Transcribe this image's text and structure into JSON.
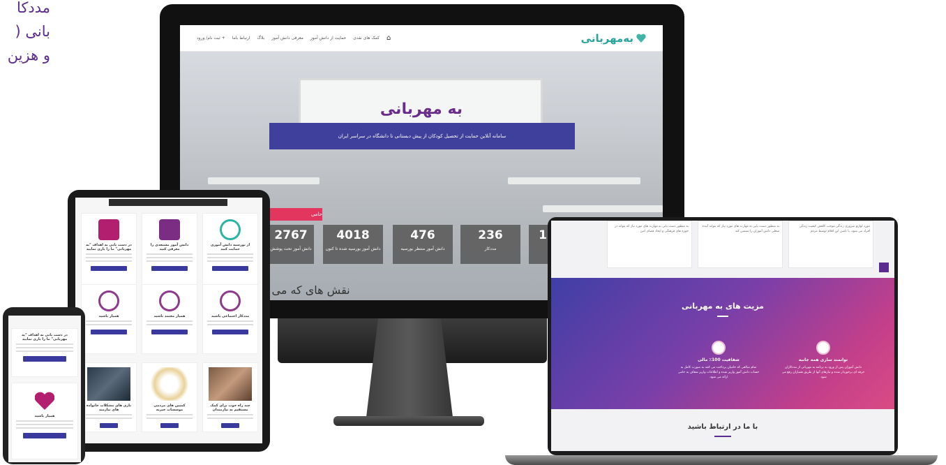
{
  "corner_text": [
    "مددکا",
    "بانی (",
    "و هزین"
  ],
  "monitor": {
    "brand": "به‌مهربانی",
    "nav_links": [
      "کمک های نقدی",
      "حمایت از دانش آموز",
      "معرفی دانش آموز",
      "بلاگ",
      "ارتباط باما",
      "ثبت نام/ ورود +"
    ],
    "hero_title": "به مهربانی",
    "hero_subtitle": "سامانه آنلاین حمایت از تحصیل کودکان از پیش دبستانی تا دانشگاه در سراسر ایران",
    "support_button": "حامی",
    "stats": [
      {
        "num": "2767",
        "label": "دانش آموز تحت پوشش"
      },
      {
        "num": "4018",
        "label": "دانش آموز بورسیه شده تا کنون"
      },
      {
        "num": "476",
        "label": "دانش آموز منتظر بورسیه"
      },
      {
        "num": "236",
        "label": "مددکار"
      },
      {
        "num": "1",
        "label": ""
      }
    ],
    "headline": "نقش های که می توانید در به مهربانی داشته باشید"
  },
  "tablet": {
    "cards": [
      {
        "title": "از بورسیه دانش آموزی حمایت کنید",
        "button": "می خواهم حامی باشم"
      },
      {
        "title": "دانش آموز مستعدی را معرفی کنید",
        "button": "می خواهم دانش آموزی معرفی کنم"
      },
      {
        "title": "در دست یابی به اهداف \"به مهربانی\" ما را یاری نمایید",
        "button": "می خواهم یاری مهربانی باشم"
      },
      {
        "title": "مددکار اجتماعی باشید",
        "button": "می خواهم مددکار باشم"
      },
      {
        "title": "همیار معتمد باشید",
        "button": "می خواهم همیار معتمد باشم"
      },
      {
        "title": "همیار باشید",
        "button": "می خواهم همیار باشم"
      },
      {
        "title": "چند راه خوب برای کمک مستقیم به نیازمندان",
        "button": "بیشتر بخوانید"
      },
      {
        "title": "کمپین های مردمی موسسات خیریه",
        "button": "بیشتر بخوانید"
      },
      {
        "title": "بازی های مشکلات خانواده های نیازمند",
        "button": "بیشتر بخوانید"
      }
    ]
  },
  "phone": {
    "card1_title": "در دست یابی به اهداف \"به مهربانی\" ما را یاری نمایید",
    "card1_button": "می خواهم یاری مهربانی باشم",
    "card2_title": "همیار باشید",
    "card2_button": "می خواهم همیار باشم"
  },
  "laptop": {
    "section_title": "مزیت های به مهربانی",
    "features": [
      {
        "title": "شفافیت 100٪ مالی",
        "text": "تمام مبالغی که حامیان پرداخت می کنند به صورت کامل به حساب دانش آموز واریز شده و اطلاعات واریز شفاف به حامی ارائه می شود."
      },
      {
        "title": "توانمند سازی همه جانبه",
        "text": "دانش آموزان پس از ورود به برنامه به مهربانی از مددکاران حرفه ای برخوردار شده و نیازهای آنها از طریق همیاران رفع می شود."
      }
    ],
    "contact_title": "با ما در ارتباط باشید",
    "cards_text": [
      "به منظور دست یابی به مهارت های مورد نیاز که بتواند در حوزه های فرهنگی و ایجاد فضای امن",
      "به منظور دست یابی به مهارت های مورد نیاز که بتواند آینده شغلی دانش آموزان را تضمین کند",
      "مورد لوازم ضروری زندگی موجب کاهش کیفیت زندگی افراد می شود، با تامین این اقلام توسط مردم"
    ]
  }
}
